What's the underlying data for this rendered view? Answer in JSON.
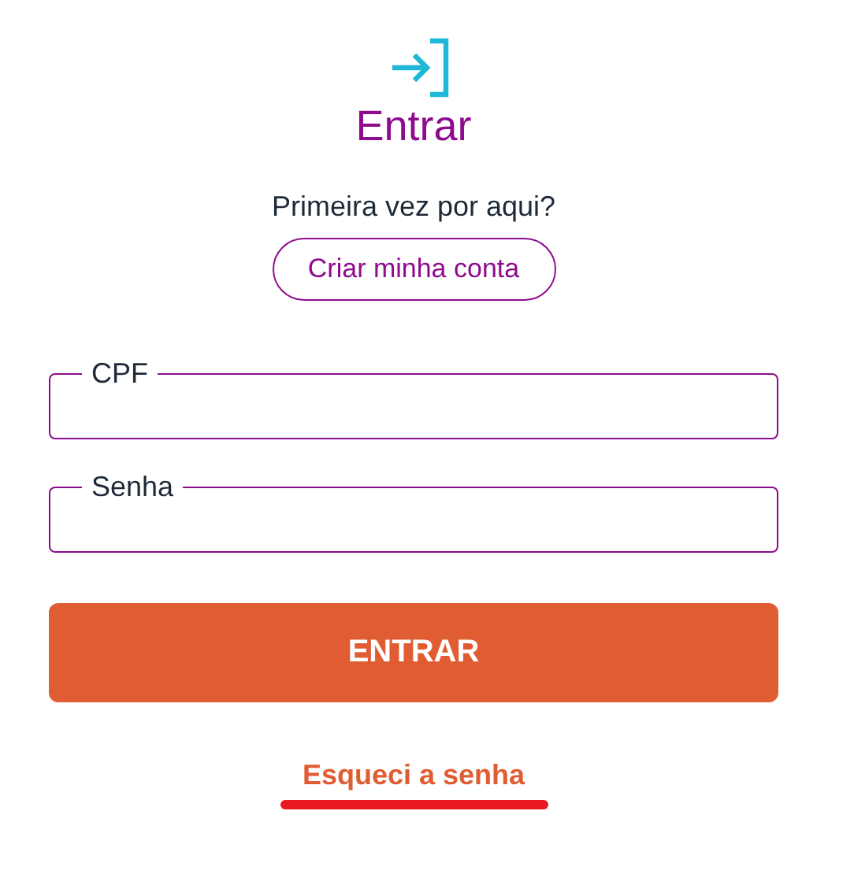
{
  "title": "Entrar",
  "signup": {
    "prompt": "Primeira vez por aqui?",
    "button": "Criar minha conta"
  },
  "fields": [
    {
      "label": "CPF"
    },
    {
      "label": "Senha"
    }
  ],
  "submit": "ENTRAR",
  "forgot_link": "Esqueci a senha"
}
